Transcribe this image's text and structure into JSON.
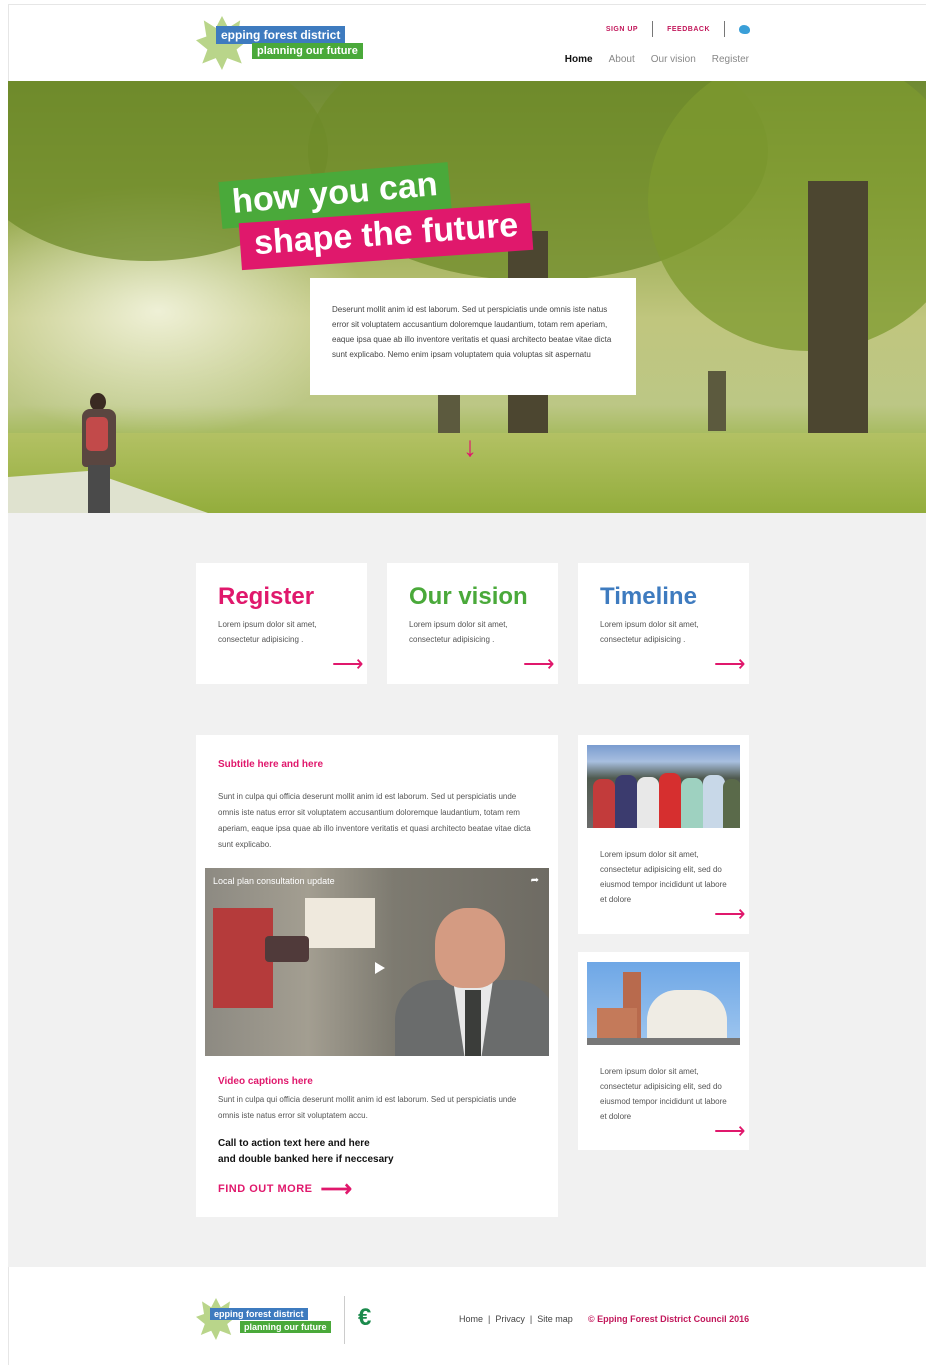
{
  "header": {
    "logo_line1": "epping forest district",
    "logo_line2": "planning our future",
    "top_links": {
      "signup": "SIGN UP",
      "feedback": "FEEDBACK"
    },
    "nav": [
      "Home",
      "About",
      "Our vision",
      "Register"
    ],
    "twitter_icon": "twitter-icon"
  },
  "hero": {
    "tag_line1": "how you can",
    "tag_line2": "shape the future",
    "intro": "Deserunt mollit anim id est laborum. Sed ut perspiciatis unde omnis iste natus error sit voluptatem accusantium doloremque laudantium, totam rem aperiam, eaque ipsa quae ab illo inventore veritatis et quasi architecto beatae vitae dicta sunt explicabo. Nemo enim ipsam voluptatem quia voluptas sit aspernatu",
    "down_arrow": "↓"
  },
  "cards": [
    {
      "title": "Register",
      "text": "Lorem ipsum dolor sit amet, consectetur adipisicing .",
      "color": "#e0186c"
    },
    {
      "title": "Our vision",
      "text": "Lorem ipsum dolor sit amet, consectetur adipisicing .",
      "color": "#4aa93a"
    },
    {
      "title": "Timeline",
      "text": "Lorem ipsum dolor sit amet, consectetur adipisicing .",
      "color": "#3e7bbf"
    }
  ],
  "arrow_glyph": "⟶",
  "article": {
    "subtitle": "Subtitle  here and here",
    "body": "Sunt in culpa qui officia deserunt mollit anim id est laborum. Sed ut perspiciatis unde omnis iste natus error sit voluptatem accusantium doloremque laudantium, totam rem aperiam, eaque ipsa quae ab illo inventore veritatis et quasi architecto beatae vitae dicta sunt explicabo.",
    "video_title": "Local plan consultation update",
    "video_caption_heading": "Video captions here",
    "video_caption": "Sunt in culpa qui officia deserunt mollit anim id est laborum. Sed ut perspiciatis unde omnis iste natus error sit voluptatem accu.",
    "cta_line1": "Call to action text here and here",
    "cta_line2": "and double banked here if neccesary",
    "find_out_more": "FIND OUT MORE"
  },
  "side_cards": [
    {
      "text": "Lorem ipsum dolor sit amet, consectetur adipisicing elit, sed do eiusmod tempor incididunt ut labore et dolore"
    },
    {
      "text": "Lorem ipsum dolor sit amet, consectetur adipisicing elit, sed do eiusmod tempor incididunt ut labore et dolore"
    }
  ],
  "footer": {
    "logo_line1": "epping forest district",
    "logo_line2": "planning our future",
    "links": [
      "Home",
      "Privacy",
      "Site map"
    ],
    "separator": "|",
    "copyright": "© Epping Forest District Council 2016"
  }
}
